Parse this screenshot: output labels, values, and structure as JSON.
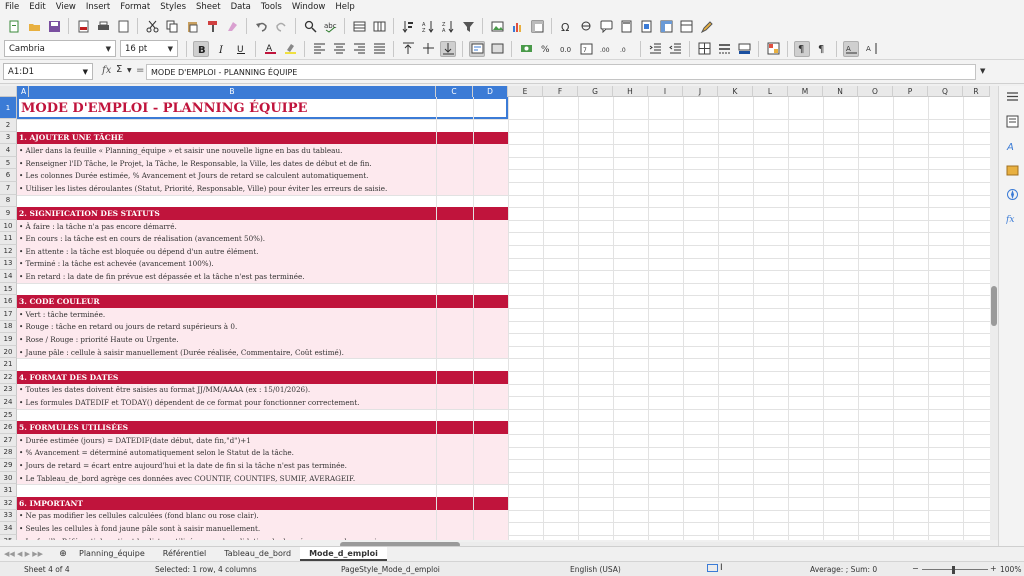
{
  "menu": [
    "File",
    "Edit",
    "View",
    "Insert",
    "Format",
    "Styles",
    "Sheet",
    "Data",
    "Tools",
    "Window",
    "Help"
  ],
  "toolbar2": {
    "font_name": "Cambria",
    "font_size": "16 pt"
  },
  "formula_bar": {
    "cell_ref": "A1:D1",
    "fx": "fx",
    "sigma": "Σ",
    "content": "MODE D'EMPLOI - PLANNING ÉQUIPE"
  },
  "columns": [
    "A",
    "B",
    "C",
    "D",
    "E",
    "F",
    "G",
    "H",
    "I",
    "J",
    "K",
    "L",
    "M",
    "N",
    "O",
    "P",
    "Q",
    "R"
  ],
  "rows": [
    {
      "n": "1",
      "kind": "title",
      "text": "MODE D'EMPLOI - PLANNING ÉQUIPE"
    },
    {
      "n": "2",
      "kind": "blank",
      "text": ""
    },
    {
      "n": "3",
      "kind": "section",
      "text": "1. AJOUTER UNE TÂCHE"
    },
    {
      "n": "4",
      "kind": "pink",
      "text": "• Aller dans la feuille « Planning_équipe » et saisir une nouvelle ligne en bas du tableau."
    },
    {
      "n": "5",
      "kind": "pink",
      "text": "• Renseigner l'ID Tâche, le Projet, la Tâche, le Responsable, la Ville, les dates de début et de fin."
    },
    {
      "n": "6",
      "kind": "pink",
      "text": "• Les colonnes Durée estimée, % Avancement et Jours de retard se calculent automatiquement."
    },
    {
      "n": "7",
      "kind": "pink",
      "text": "• Utiliser les listes déroulantes (Statut, Priorité, Responsable, Ville) pour éviter les erreurs de saisie."
    },
    {
      "n": "8",
      "kind": "blank",
      "text": ""
    },
    {
      "n": "9",
      "kind": "section",
      "text": "2. SIGNIFICATION DES STATUTS"
    },
    {
      "n": "10",
      "kind": "pink",
      "text": "• À faire : la tâche n'a pas encore démarré."
    },
    {
      "n": "11",
      "kind": "pink",
      "text": "• En cours : la tâche est en cours de réalisation (avancement 50%)."
    },
    {
      "n": "12",
      "kind": "pink",
      "text": "• En attente : la tâche est bloquée ou dépend d'un autre élément."
    },
    {
      "n": "13",
      "kind": "pink",
      "text": "• Terminé : la tâche est achevée (avancement 100%)."
    },
    {
      "n": "14",
      "kind": "pink",
      "text": "• En retard : la date de fin prévue est dépassée et la tâche n'est pas terminée."
    },
    {
      "n": "15",
      "kind": "blank",
      "text": ""
    },
    {
      "n": "16",
      "kind": "section",
      "text": "3. CODE COULEUR"
    },
    {
      "n": "17",
      "kind": "pink",
      "text": "• Vert : tâche terminée."
    },
    {
      "n": "18",
      "kind": "pink",
      "text": "• Rouge : tâche en retard ou jours de retard supérieurs à 0."
    },
    {
      "n": "19",
      "kind": "pink",
      "text": "• Rose / Rouge : priorité Haute ou Urgente."
    },
    {
      "n": "20",
      "kind": "pink",
      "text": "• Jaune pâle : cellule à saisir manuellement (Durée réalisée, Commentaire, Coût estimé)."
    },
    {
      "n": "21",
      "kind": "blank",
      "text": ""
    },
    {
      "n": "22",
      "kind": "section",
      "text": "4. FORMAT DES DATES"
    },
    {
      "n": "23",
      "kind": "pink",
      "text": "• Toutes les dates doivent être saisies au format JJ/MM/AAAA (ex : 15/01/2026)."
    },
    {
      "n": "24",
      "kind": "pink",
      "text": "• Les formules DATEDIF et TODAY() dépendent de ce format pour fonctionner correctement."
    },
    {
      "n": "25",
      "kind": "blank",
      "text": ""
    },
    {
      "n": "26",
      "kind": "section",
      "text": "5. FORMULES UTILISÉES"
    },
    {
      "n": "27",
      "kind": "pink",
      "text": "• Durée estimée (jours) = DATEDIF(date début, date fin,\"d\")+1"
    },
    {
      "n": "28",
      "kind": "pink",
      "text": "• % Avancement = déterminé automatiquement selon le Statut de la tâche."
    },
    {
      "n": "29",
      "kind": "pink",
      "text": "• Jours de retard = écart entre aujourd'hui et la date de fin si la tâche n'est pas terminée."
    },
    {
      "n": "30",
      "kind": "pink",
      "text": "• Le Tableau_de_bord agrège ces données avec COUNTIF, COUNTIFS, SUMIF, AVERAGEIF."
    },
    {
      "n": "31",
      "kind": "blank",
      "text": ""
    },
    {
      "n": "32",
      "kind": "section",
      "text": "6. IMPORTANT"
    },
    {
      "n": "33",
      "kind": "pink",
      "text": "• Ne pas modifier les cellules calculées (fond blanc ou rose clair)."
    },
    {
      "n": "34",
      "kind": "pink",
      "text": "• Seules les cellules à fond jaune pâle sont à saisir manuellement."
    },
    {
      "n": "35",
      "kind": "pink",
      "text": "• La feuille Référentiel contient les listes utilisées pour la validation de données : ne pas la supprimer."
    }
  ],
  "tabs": [
    "Planning_équipe",
    "Référentiel",
    "Tableau_de_bord",
    "Mode_d_emploi"
  ],
  "active_tab": "Mode_d_emploi",
  "status": {
    "sheet": "Sheet 4 of 4",
    "selection": "Selected: 1 row, 4 columns",
    "page_style": "PageStyle_Mode_d_emploi",
    "language": "English (USA)",
    "summary": "Average: ; Sum: 0",
    "zoom": "100%"
  },
  "colors": {
    "section": "#c0143c",
    "pink": "#fde9ee",
    "selection": "#3b7bd6"
  }
}
